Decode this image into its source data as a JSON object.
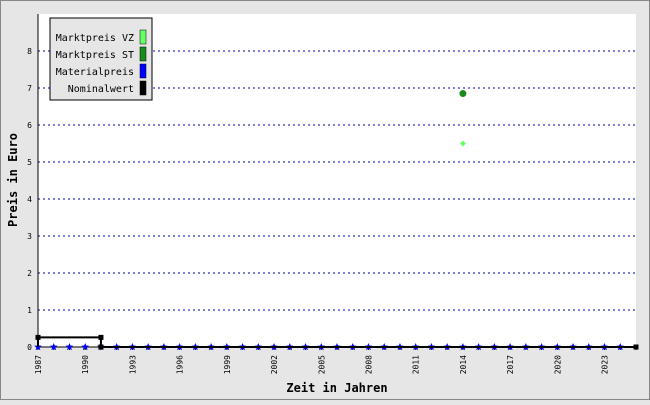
{
  "chart_data": {
    "type": "scatter",
    "xlabel": "Zeit in Jahren",
    "ylabel": "Preis in Euro",
    "xlim": [
      1987,
      2025
    ],
    "ylim": [
      0,
      9
    ],
    "x_ticks": [
      1987,
      1990,
      1993,
      1996,
      1999,
      2002,
      2005,
      2008,
      2011,
      2014,
      2017,
      2020,
      2023
    ],
    "y_ticks": [
      0,
      1,
      2,
      3,
      4,
      5,
      6,
      7,
      8
    ],
    "grid": "horizontal dotted",
    "legend_position": "top-left",
    "series": [
      {
        "name": "Marktpreis VZ",
        "color": "#66ff66",
        "marker": "diamond",
        "points": [
          [
            2014,
            5.5
          ]
        ]
      },
      {
        "name": "Marktpreis ST",
        "color": "#1a8c1a",
        "marker": "circle",
        "points": [
          [
            2014,
            6.85
          ]
        ]
      },
      {
        "name": "Materialpreis",
        "color": "#0000ff",
        "marker": "star",
        "points": [
          [
            1987,
            0
          ],
          [
            1988,
            0
          ],
          [
            1989,
            0
          ],
          [
            1990,
            0
          ],
          [
            1991,
            0
          ],
          [
            1992,
            0
          ],
          [
            1993,
            0
          ],
          [
            1994,
            0
          ],
          [
            1995,
            0
          ],
          [
            1996,
            0
          ],
          [
            1997,
            0
          ],
          [
            1998,
            0
          ],
          [
            1999,
            0
          ],
          [
            2000,
            0
          ],
          [
            2001,
            0
          ],
          [
            2002,
            0
          ],
          [
            2003,
            0
          ],
          [
            2004,
            0
          ],
          [
            2005,
            0
          ],
          [
            2006,
            0
          ],
          [
            2007,
            0
          ],
          [
            2008,
            0
          ],
          [
            2009,
            0
          ],
          [
            2010,
            0
          ],
          [
            2011,
            0
          ],
          [
            2012,
            0
          ],
          [
            2013,
            0
          ],
          [
            2014,
            0
          ],
          [
            2015,
            0
          ],
          [
            2016,
            0
          ],
          [
            2017,
            0
          ],
          [
            2018,
            0
          ],
          [
            2019,
            0
          ],
          [
            2020,
            0
          ],
          [
            2021,
            0
          ],
          [
            2022,
            0
          ],
          [
            2023,
            0
          ],
          [
            2024,
            0
          ]
        ]
      },
      {
        "name": "Nominalwert",
        "color": "#000000",
        "marker": "step",
        "points": [
          [
            1987,
            0.26
          ],
          [
            1991,
            0.26
          ],
          [
            1991,
            0
          ],
          [
            2025,
            0
          ]
        ]
      }
    ]
  }
}
